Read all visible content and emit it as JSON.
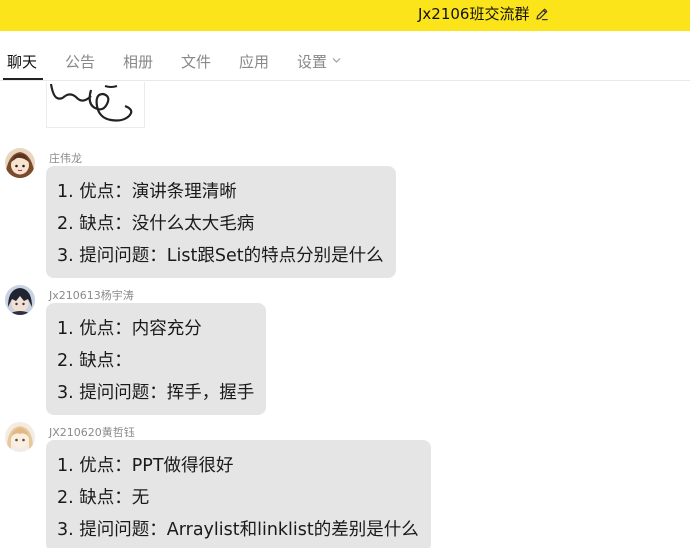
{
  "header": {
    "title": "Jx2106班交流群",
    "edit_icon": "edit-pencil-icon"
  },
  "tabs": [
    {
      "label": "聊天",
      "active": true
    },
    {
      "label": "公告",
      "active": false
    },
    {
      "label": "相册",
      "active": false
    },
    {
      "label": "文件",
      "active": false
    },
    {
      "label": "应用",
      "active": false
    },
    {
      "label": "设置",
      "active": false,
      "dropdown": true
    }
  ],
  "messages": [
    {
      "sender": "庄伟龙",
      "lines": [
        "1. 优点：演讲条理清晰",
        "2. 缺点：没什么太大毛病",
        "3. 提问问题：List跟Set的特点分别是什么"
      ]
    },
    {
      "sender": "Jx210613杨宇涛",
      "lines": [
        "1. 优点：内容充分",
        "2. 缺点：",
        "3. 提问问题：挥手，握手"
      ]
    },
    {
      "sender": "JX210620黄哲钰",
      "lines": [
        "1. 优点：PPT做得很好",
        "2. 缺点：无",
        "3. 提问问题：Arraylist和linklist的差别是什么"
      ]
    }
  ],
  "colors": {
    "header_bg": "#fce41a",
    "bubble_bg": "#e5e5e5",
    "active_tab": "#111111",
    "inactive_tab": "#888888"
  }
}
